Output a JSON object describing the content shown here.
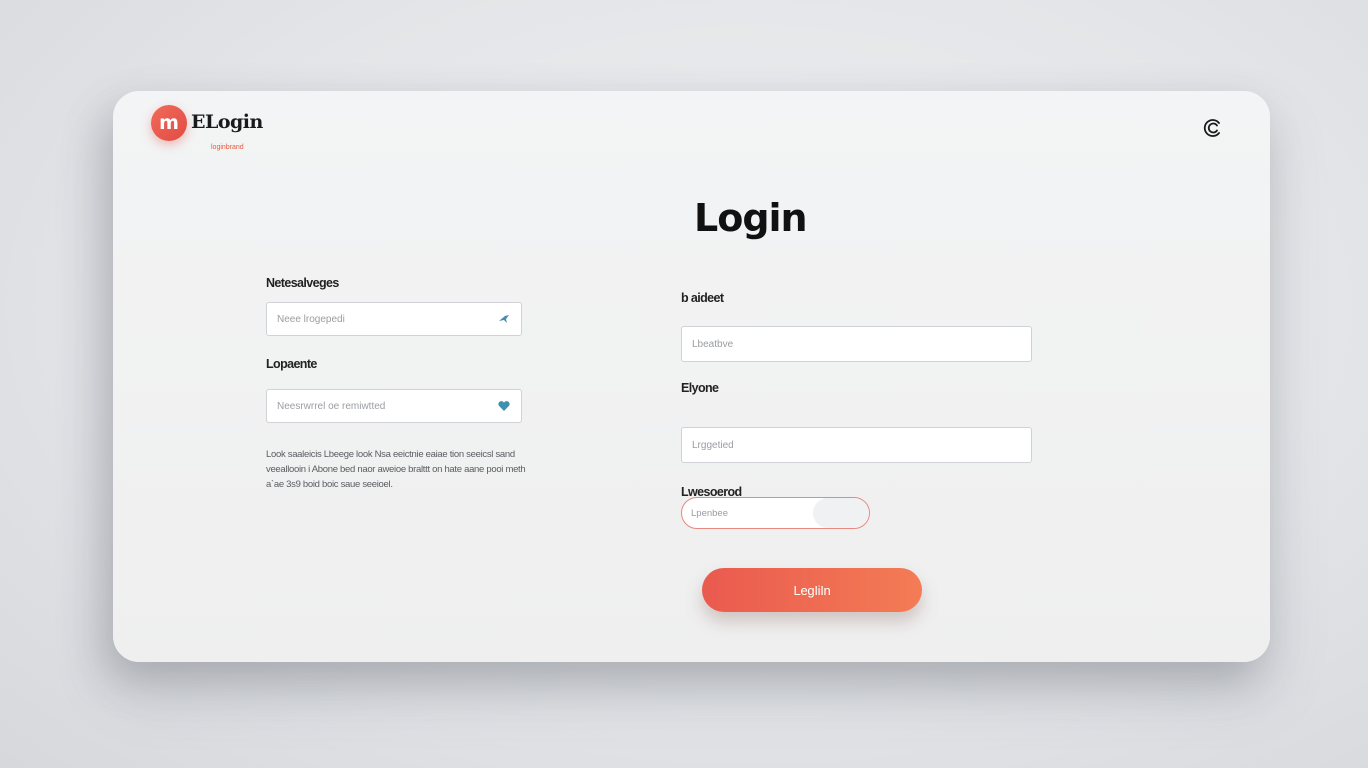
{
  "brand": {
    "logo_letter": "m",
    "name": "ELogin",
    "tagline": "loginbrand",
    "accent": "#e55a3f"
  },
  "corner_icon": "c-logo-icon",
  "title": "Logi​n",
  "left_form": {
    "field1": {
      "label": "Netesalveges",
      "placeholder": "Neee lrogepedi",
      "icon": "bird-icon"
    },
    "field2": {
      "label": "Lopaente",
      "placeholder": "Neesrwrrel oe remiwtted",
      "icon": "heart-icon"
    },
    "helper_text": "Look saaleicis Lbeege look Nsa eeictnie eaiae tion seeicsl sand veeallooin i Abone bed naor aweioe bralttt on hate aane pooi meth a`ae 3s9 boid boic saue seeioel."
  },
  "right_form": {
    "field1": {
      "label": "b aideet",
      "placeholder": "Lbeatbve"
    },
    "field2": {
      "label": "Elyone",
      "placeholder": "Lrggetied"
    },
    "field3": {
      "label": "Lwesoerod",
      "placeholder": "Lpenbee"
    }
  },
  "login_button": {
    "label": "LegIiIn",
    "color_start": "#ea5a4f",
    "color_end": "#f37c55"
  }
}
